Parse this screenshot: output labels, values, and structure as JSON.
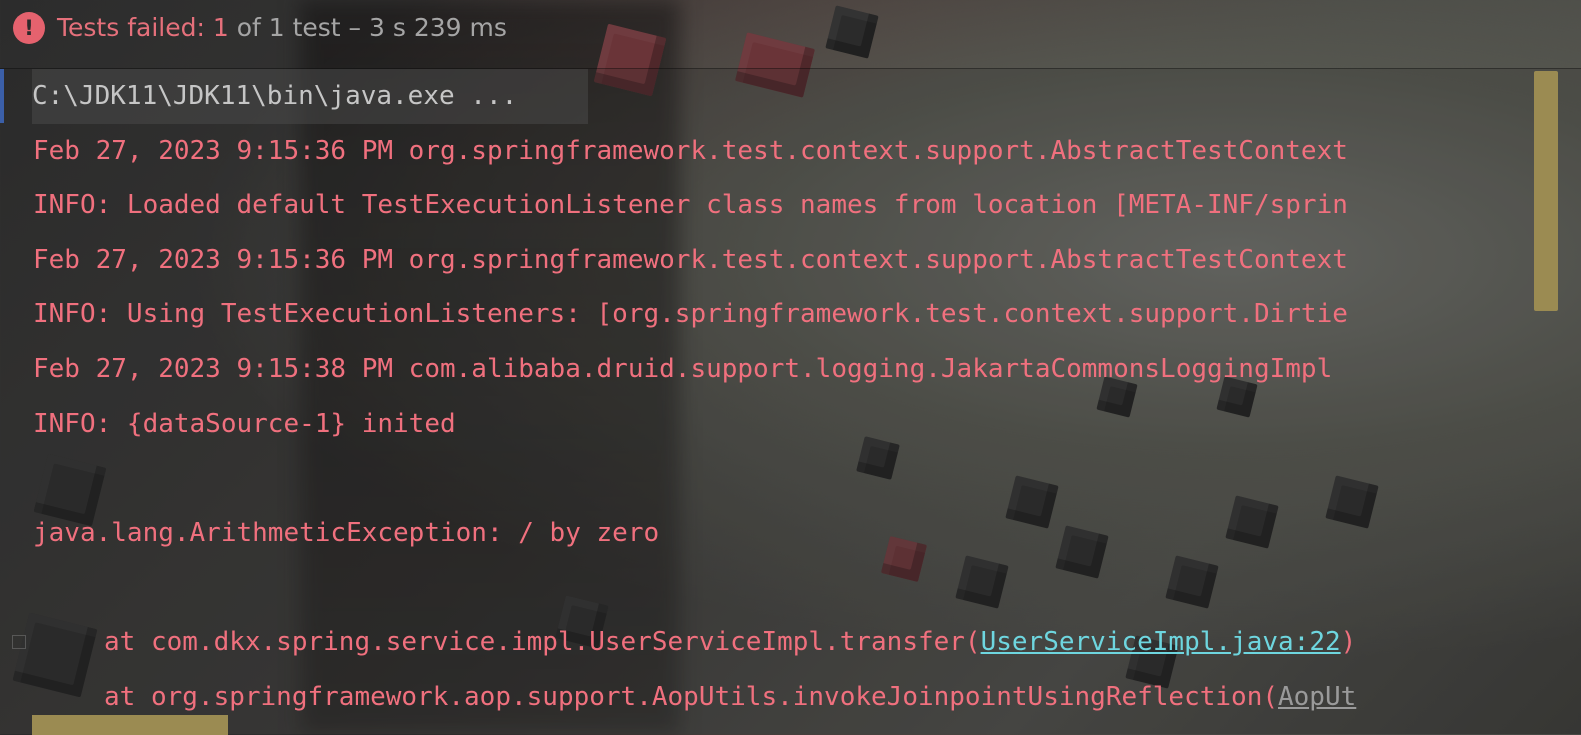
{
  "status": {
    "icon": "error-icon",
    "prefix": "Tests failed: ",
    "failed_count": "1",
    "rest": " of 1 test – 3 s 239 ms"
  },
  "console": {
    "command_line": "C:\\JDK11\\JDK11\\bin\\java.exe ...",
    "log_lines": [
      "Feb 27, 2023 9:15:36 PM org.springframework.test.context.support.AbstractTestContext",
      "INFO: Loaded default TestExecutionListener class names from location [META-INF/sprin",
      "Feb 27, 2023 9:15:36 PM org.springframework.test.context.support.AbstractTestContext",
      "INFO: Using TestExecutionListeners: [org.springframework.test.context.support.Dirtie",
      "Feb 27, 2023 9:15:38 PM com.alibaba.druid.support.logging.JakartaCommonsLoggingImpl",
      "INFO: {dataSource-1} inited"
    ],
    "exception": "java.lang.ArithmeticException: / by zero",
    "stack": [
      {
        "prefix": "at com.dkx.spring.service.impl.UserServiceImpl.transfer(",
        "link": "UserServiceImpl.java:22",
        "suffix": ")"
      },
      {
        "prefix": "at org.springframework.aop.support.AopUtils.invokeJoinpointUsingReflection(",
        "link": "AopUt",
        "suffix": ""
      }
    ]
  },
  "colors": {
    "error_text": "#f0707e",
    "link": "#6ed6df",
    "scrollbar": "#9b8b52",
    "status_icon": "#e5626e"
  }
}
